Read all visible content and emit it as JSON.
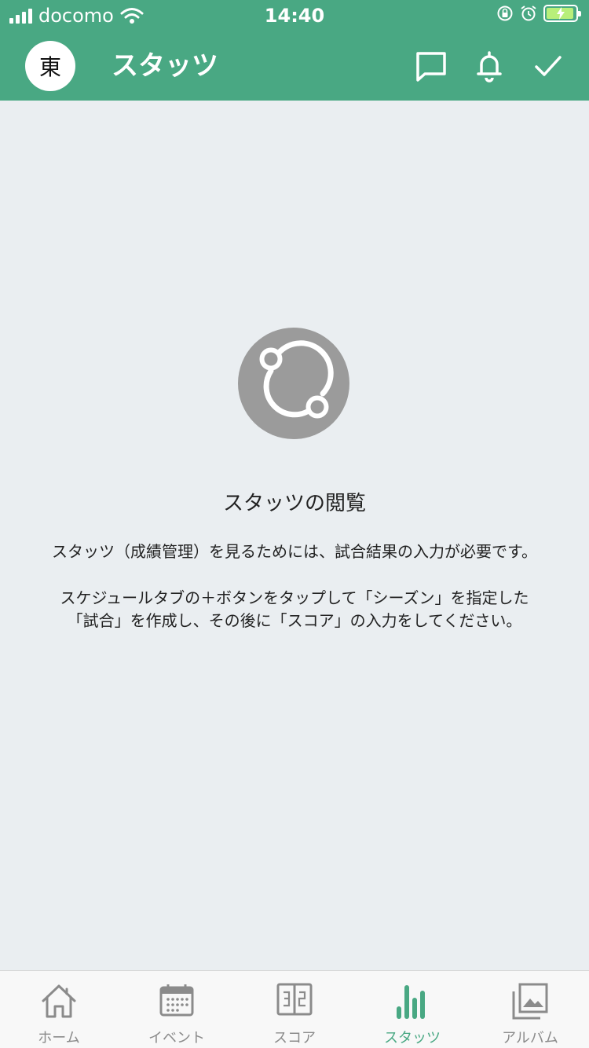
{
  "status_bar": {
    "carrier": "docomo",
    "time": "14:40"
  },
  "header": {
    "avatar_char": "東",
    "title": "スタッツ"
  },
  "empty_state": {
    "title": "スタッツの閲覧",
    "line1": "スタッツ（成績管理）を見るためには、試合結果の入力が必要です。",
    "line2": "スケジュールタブの＋ボタンをタップして「シーズン」を指定した",
    "line3": "「試合」を作成し、その後に「スコア」の入力をしてください。"
  },
  "tabs": [
    {
      "label": "ホーム",
      "icon": "home-icon"
    },
    {
      "label": "イベント",
      "icon": "calendar-icon"
    },
    {
      "label": "スコア",
      "icon": "scoreboard-icon"
    },
    {
      "label": "スタッツ",
      "icon": "bar-chart-icon"
    },
    {
      "label": "アルバム",
      "icon": "album-icon"
    }
  ],
  "colors": {
    "accent": "#49a883",
    "inactive": "#8b8b8b",
    "background": "#eaeef1"
  }
}
